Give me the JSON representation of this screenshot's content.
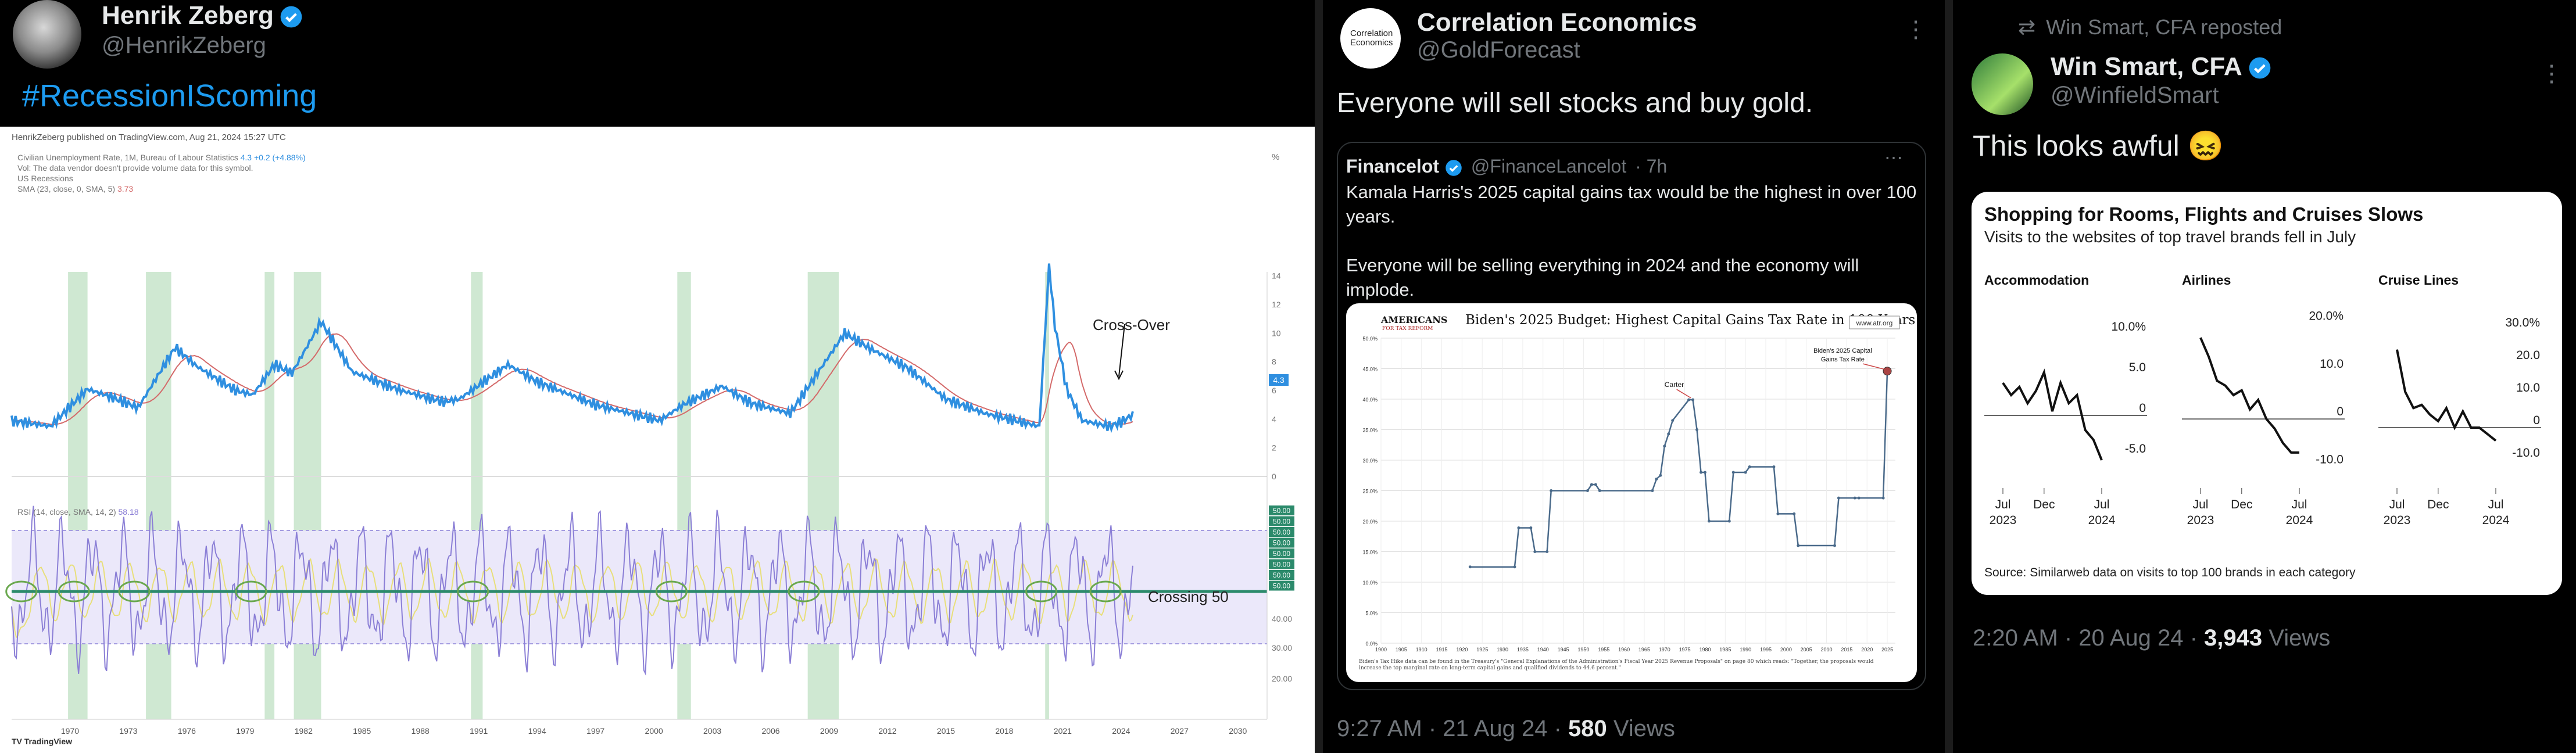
{
  "colors": {
    "bg": "#000000",
    "text": "#e7e9ea",
    "muted": "#71767b",
    "link": "#1d9bf0",
    "verified": "#1d9bf0",
    "tv_blue": "#2f8fe0",
    "tv_red": "#d46a6a",
    "tv_purple": "#8b7fd6",
    "tv_yellow": "#e8df7a",
    "tv_green": "#2b8a6b",
    "rec_band": "#cfe8d2"
  },
  "p1": {
    "name": "Henrik Zeberg",
    "handle": "@HenrikZeberg",
    "tweet": "#RecessionIScoming",
    "chart": {
      "header": "HenrikZeberg published on TradingView.com, Aug 21, 2024 15:27 UTC",
      "legend1": "Civilian Unemployment Rate, 1M, Bureau of Labour Statistics",
      "legend1_val": "4.3 +0.2 (+4.88%)",
      "legend2": "Vol: The data vendor doesn't provide volume data for this symbol.",
      "legend3": "US Recessions",
      "legend4": "SMA (23, close, 0, SMA, 5)",
      "legend4_val": "3.73",
      "y_unit": "%",
      "y_ticks": [
        "14",
        "12",
        "10",
        "8",
        "6",
        "4",
        "2",
        "0"
      ],
      "price_label": "4.3",
      "annot_crossover": "Cross-Over",
      "annot_crossing": "Crossing 50",
      "rsi_legend": "RSI (14, close, SMA, 14, 2)",
      "rsi_legend_val": "58.18",
      "rsi_ticks": [
        "50.00",
        "40.00",
        "30.00",
        "20.00"
      ],
      "rsi_top_labels": [
        "50.00",
        "50.00",
        "50.00",
        "50.00",
        "50.00",
        "50.00",
        "50.00",
        "50.00"
      ],
      "x_ticks": [
        "1970",
        "1973",
        "1976",
        "1979",
        "1982",
        "1985",
        "1988",
        "1991",
        "1994",
        "1997",
        "2000",
        "2003",
        "2006",
        "2009",
        "2012",
        "2015",
        "2018",
        "2021",
        "2024",
        "2027",
        "2030"
      ],
      "footer": "TradingView"
    }
  },
  "p2": {
    "name": "Correlation Economics",
    "handle": "@GoldForecast",
    "avatar_text": "Correlation Economics",
    "tweet": "Everyone will sell stocks and buy gold.",
    "quote": {
      "name": "Financelot",
      "handle": "@FinanceLancelot",
      "time": "· 7h",
      "text1": "Kamala Harris's 2025 capital gains tax would be the highest in over 100",
      "text1b": "years.",
      "text2": "Everyone will be selling everything in 2024 and the economy will",
      "text2b": "implode."
    },
    "card": {
      "logo_top": "AMERICANS",
      "logo_bottom": "FOR TAX REFORM",
      "title": "Biden's 2025 Budget: Highest Capital Gains Tax Rate in 100 Years",
      "url": "www.atr.org",
      "annot_carter": "Carter",
      "annot_biden": "Biden's 2025 Capital Gains Tax Rate",
      "footnote": "Biden's Tax Hike data can be found in the Treasury's \"General Explanations of the Administration's Fiscal Year 2025 Revenue Proposals\" on page 80 which reads: \"Together, the proposals would increase the top marginal rate on long-term capital gains and qualified dividends to 44.6 percent.\""
    },
    "chart_data": {
      "type": "line",
      "title": "Biden's 2025 Budget: Highest Capital Gains Tax Rate in 100 Years",
      "ylim": [
        0,
        50
      ],
      "y_ticks": [
        "0.0%",
        "5.0%",
        "10.0%",
        "15.0%",
        "20.0%",
        "25.0%",
        "30.0%",
        "35.0%",
        "40.0%",
        "45.0%",
        "50.0%"
      ],
      "x_ticks": [
        "1900",
        "1905",
        "1910",
        "1915",
        "1920",
        "1925",
        "1930",
        "1935",
        "1940",
        "1945",
        "1950",
        "1955",
        "1960",
        "1965",
        "1970",
        "1975",
        "1980",
        "1985",
        "1990",
        "1995",
        "2000",
        "2005",
        "2010",
        "2015",
        "2020",
        "2025"
      ],
      "x": [
        1922,
        1933,
        1934,
        1937,
        1938,
        1941,
        1942,
        1951,
        1952,
        1953,
        1954,
        1967,
        1968,
        1969,
        1970,
        1971,
        1972,
        1976,
        1977,
        1978,
        1979,
        1980,
        1981,
        1986,
        1987,
        1990,
        1991,
        1997,
        1998,
        2002,
        2003,
        2012,
        2013,
        2017,
        2018,
        2024,
        2025
      ],
      "y": [
        12.5,
        12.5,
        18.9,
        18.9,
        15,
        15,
        25,
        25,
        26,
        26,
        25,
        25,
        26.9,
        27.5,
        32.3,
        34.3,
        36.5,
        39.9,
        39.9,
        35,
        28,
        28,
        20,
        20,
        28,
        28,
        28.9,
        28.9,
        21.2,
        21.2,
        16,
        16,
        23.8,
        23.8,
        23.8,
        23.8,
        44.6
      ]
    },
    "meta_time": "9:27 AM · 21 Aug 24 ·",
    "meta_views_num": "580",
    "meta_views_label": "Views"
  },
  "p3": {
    "repost": "Win Smart, CFA reposted",
    "name": "Win Smart, CFA",
    "handle": "@WinfieldSmart",
    "tweet": "This looks awful",
    "emoji": "😖",
    "card": {
      "title": "Shopping for Rooms, Flights and Cruises Slows",
      "subtitle": "Visits to the websites of top travel brands fell in July",
      "source": "Source: Similarweb data on visits to top 100 brands in each category"
    },
    "chart_data": [
      {
        "type": "line",
        "title": "Accommodation",
        "ylim": [
          -7.5,
          12.5
        ],
        "y_ticks": [
          "10.0%",
          "5.0",
          "0",
          "-5.0"
        ],
        "x_ticks": [
          "Jul 2023",
          "Dec",
          "Jul 2024"
        ],
        "x": [
          0,
          1,
          2,
          3,
          4,
          5,
          6,
          7,
          8,
          9,
          10,
          11,
          12
        ],
        "y": [
          4,
          2.5,
          3.5,
          1.5,
          3,
          5.3,
          0.5,
          4,
          1.5,
          2.5,
          -1.8,
          -3,
          -5.5
        ]
      },
      {
        "type": "line",
        "title": "Airlines",
        "ylim": [
          -12,
          22
        ],
        "y_ticks": [
          "20.0%",
          "10.0",
          "0",
          "-10.0"
        ],
        "x_ticks": [
          "Jul 2023",
          "Dec",
          "Jul 2024"
        ],
        "x": [
          0,
          1,
          2,
          3,
          4,
          5,
          6,
          7,
          8,
          9,
          10,
          11,
          12
        ],
        "y": [
          17,
          13,
          8,
          7,
          5,
          6,
          2,
          4,
          0,
          -2,
          -5,
          -7,
          -7
        ]
      },
      {
        "type": "line",
        "title": "Cruise Lines",
        "ylim": [
          -15,
          35
        ],
        "y_ticks": [
          "30.0%",
          "20.0",
          "10.0",
          "0",
          "-10.0"
        ],
        "x_ticks": [
          "Jul 2023",
          "Dec",
          "Jul 2024"
        ],
        "x": [
          0,
          1,
          2,
          3,
          4,
          5,
          6,
          7,
          8,
          9,
          10,
          11,
          12
        ],
        "y": [
          24,
          11,
          6,
          7,
          4,
          2,
          6,
          0,
          5,
          0,
          0,
          -2,
          -4
        ]
      }
    ],
    "meta_time": "2:20 AM · 20 Aug 24 ·",
    "meta_views_num": "3,943",
    "meta_views_label": "Views"
  }
}
